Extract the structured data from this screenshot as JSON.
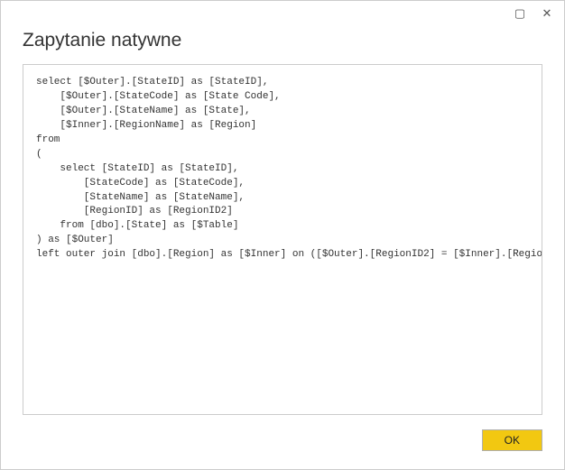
{
  "dialog": {
    "title": "Zapytanie natywne",
    "query_text": "select [$Outer].[StateID] as [StateID],\n    [$Outer].[StateCode] as [State Code],\n    [$Outer].[StateName] as [State],\n    [$Inner].[RegionName] as [Region]\nfrom \n(\n    select [StateID] as [StateID],\n        [StateCode] as [StateCode],\n        [StateName] as [StateName],\n        [RegionID] as [RegionID2]\n    from [dbo].[State] as [$Table]\n) as [$Outer]\nleft outer join [dbo].[Region] as [$Inner] on ([$Outer].[RegionID2] = [$Inner].[RegionID])",
    "ok_label": "OK"
  },
  "icons": {
    "maximize": "▢",
    "close": "✕"
  }
}
